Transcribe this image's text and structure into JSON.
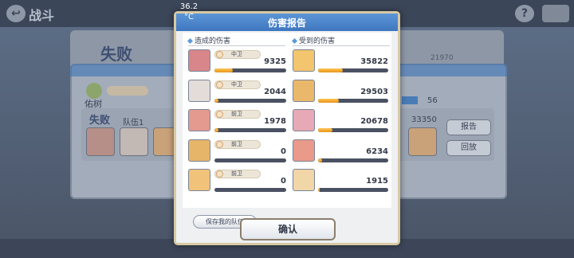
{
  "status_bar": {
    "temperature": "36.2\n°C"
  },
  "background": {
    "title": "战斗",
    "defeat_label": "失败",
    "top_value": "21970",
    "player_name": "佑树",
    "progress_value": "56",
    "team_label": "队伍1",
    "score": "33350",
    "report_button": "报告",
    "replay_button": "回放"
  },
  "modal": {
    "title": "伤害报告",
    "dealt_header": "造成的伤害",
    "received_header": "受到的伤害",
    "save_button": "保存我的队伍",
    "confirm_button": "确认",
    "dealt": [
      {
        "position": "中卫",
        "value": 9325,
        "display": "9325",
        "fill": 0.26
      },
      {
        "position": "中卫",
        "value": 2044,
        "display": "2044",
        "fill": 0.06
      },
      {
        "position": "前卫",
        "value": 1978,
        "display": "1978",
        "fill": 0.06
      },
      {
        "position": "前卫",
        "value": 0,
        "display": "0",
        "fill": 0
      },
      {
        "position": "前卫",
        "value": 0,
        "display": "0",
        "fill": 0
      }
    ],
    "received": [
      {
        "value": 35822,
        "display": "35822",
        "fill": 0.35
      },
      {
        "value": 29503,
        "display": "29503",
        "fill": 0.29
      },
      {
        "value": 20678,
        "display": "20678",
        "fill": 0.2
      },
      {
        "value": 6234,
        "display": "6234",
        "fill": 0.06
      },
      {
        "value": 1915,
        "display": "1915",
        "fill": 0.02
      }
    ]
  },
  "colors": {
    "header_blue": "#4a86cc",
    "bar_fill": "#f5a524",
    "bar_track": "#4a5162",
    "frame_gold": "#d8c9a4"
  }
}
